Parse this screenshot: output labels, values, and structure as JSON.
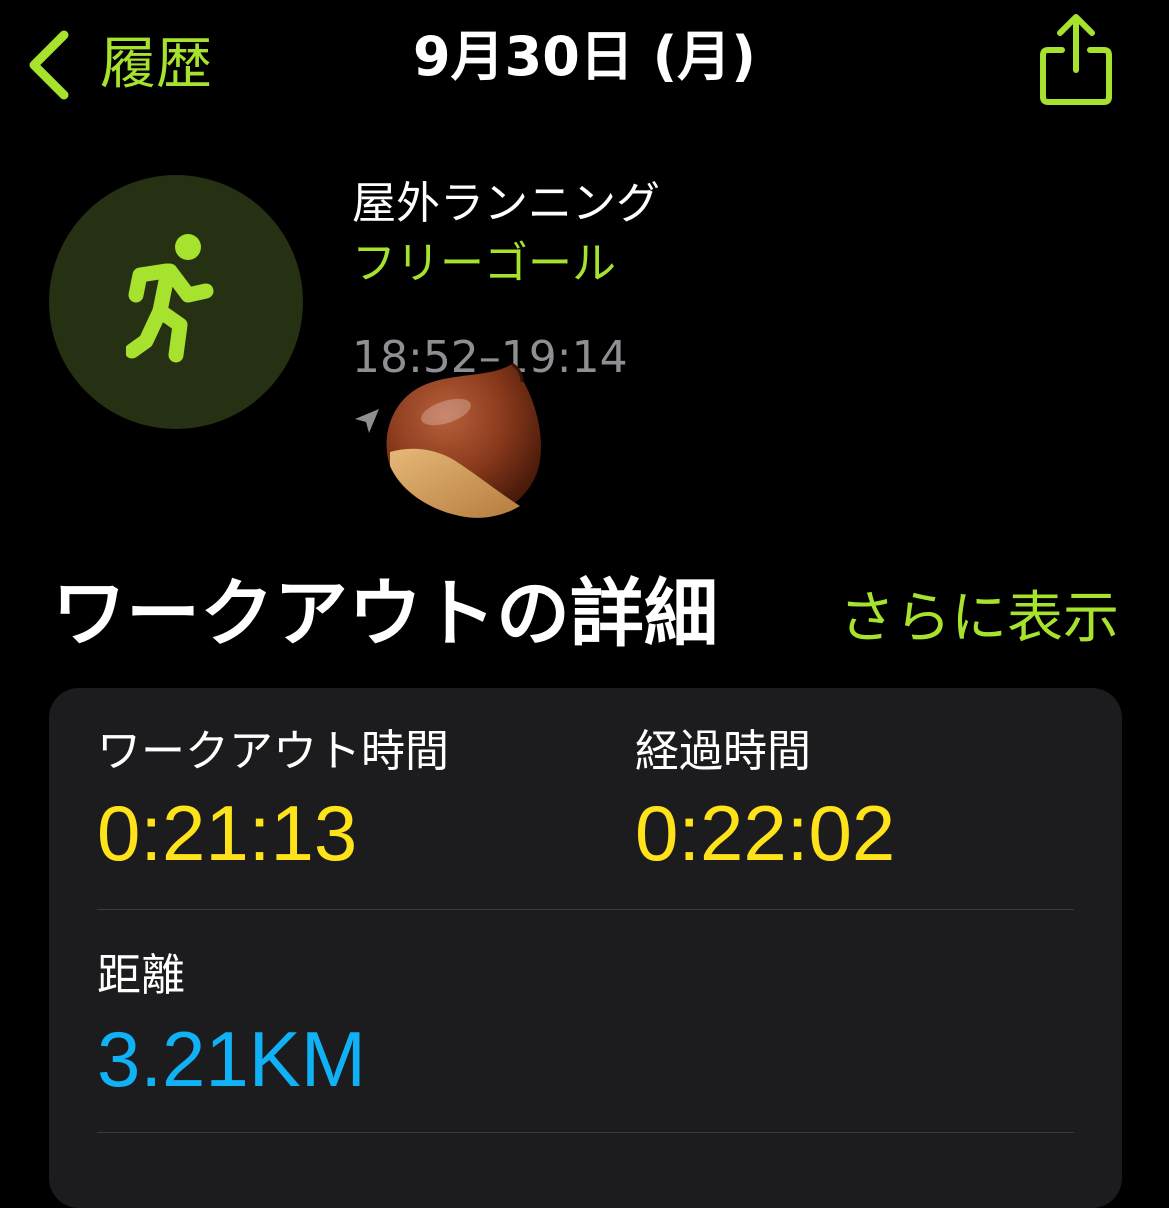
{
  "nav": {
    "back_label": "履歴",
    "title": "9月30日 (月)"
  },
  "workout": {
    "type": "屋外ランニング",
    "goal": "フリーゴール",
    "time_range": "18:52–19:14"
  },
  "section": {
    "title": "ワークアウトの詳細",
    "show_more": "さらに表示"
  },
  "metrics": {
    "workout_time_label": "ワークアウト時間",
    "workout_time_value": "0:21:13",
    "elapsed_time_label": "経過時間",
    "elapsed_time_value": "0:22:02",
    "distance_label": "距離",
    "distance_value": "3.21KM"
  },
  "colors": {
    "accent_green": "#a6e22e",
    "time_yellow": "#ffe31a",
    "distance_blue": "#10b1f5"
  }
}
